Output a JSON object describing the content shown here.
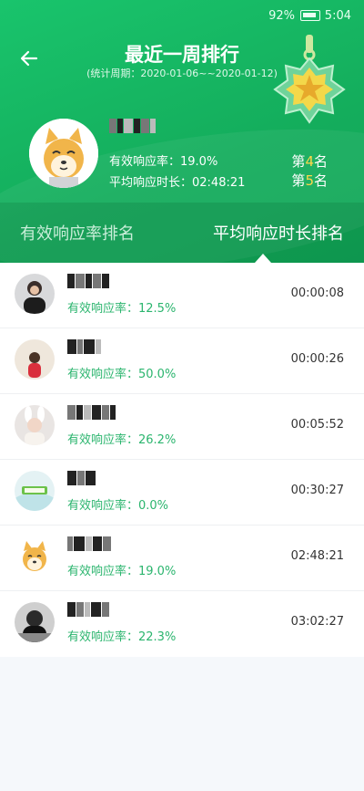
{
  "status_bar": {
    "battery": "92%",
    "time": "5:04"
  },
  "header": {
    "title": "最近一周排行",
    "subtitle": "(统计周期：2020-01-06~~2020-01-12)",
    "my_stats": {
      "rate": "有效响应率：19.0%",
      "avg_time": "平均响应时长：02:48:21",
      "rank_rate_prefix": "第",
      "rank_rate_num": "4",
      "rank_rate_suffix": "名",
      "rank_time_prefix": "第",
      "rank_time_num": "5",
      "rank_time_suffix": "名"
    }
  },
  "tabs": {
    "rate_tab": "有效响应率排名",
    "time_tab": "平均响应时长排名"
  },
  "list": [
    {
      "rate": "有效响应率：12.5%",
      "duration": "00:00:08",
      "avatar": "man-photo"
    },
    {
      "rate": "有效响应率：50.0%",
      "duration": "00:00:26",
      "avatar": "girl-photo"
    },
    {
      "rate": "有效响应率：26.2%",
      "duration": "00:05:52",
      "avatar": "bunny-ears-photo"
    },
    {
      "rate": "有效响应率：0.0%",
      "duration": "00:30:27",
      "avatar": "logo-photo"
    },
    {
      "rate": "有效响应率：19.0%",
      "duration": "02:48:21",
      "avatar": "dog-cartoon"
    },
    {
      "rate": "有效响应率：22.3%",
      "duration": "03:02:27",
      "avatar": "dark-photo"
    }
  ],
  "colors": {
    "brand_green": "#14ad5c",
    "rate_text": "#2bb56e",
    "rank_highlight": "#ffd84a"
  }
}
